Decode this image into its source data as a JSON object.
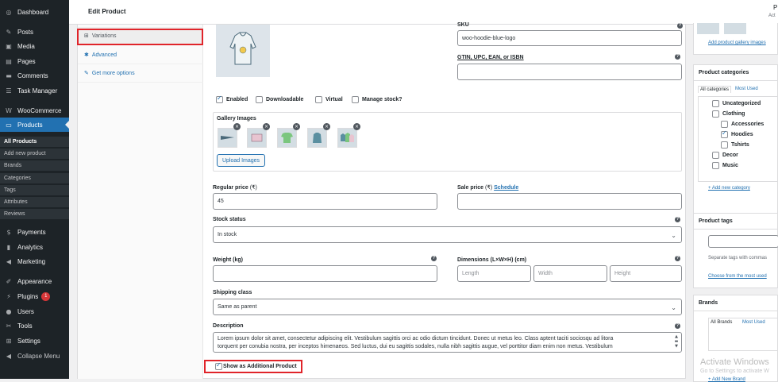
{
  "sidebar": {
    "items": [
      {
        "icon": "dashboard-icon",
        "glyph": "◎",
        "label": "Dashboard"
      },
      {
        "icon": "pin-icon",
        "glyph": "✎",
        "label": "Posts"
      },
      {
        "icon": "media-icon",
        "glyph": "▣",
        "label": "Media"
      },
      {
        "icon": "pages-icon",
        "glyph": "▤",
        "label": "Pages"
      },
      {
        "icon": "comment-icon",
        "glyph": "▬",
        "label": "Comments"
      },
      {
        "icon": "list-icon",
        "glyph": "☰",
        "label": "Task Manager"
      },
      {
        "icon": "woo-icon",
        "glyph": "W",
        "label": "WooCommerce"
      },
      {
        "icon": "products-icon",
        "glyph": "▭",
        "label": "Products"
      },
      {
        "icon": "payments-icon",
        "glyph": "$",
        "label": "Payments"
      },
      {
        "icon": "analytics-icon",
        "glyph": "▮",
        "label": "Analytics"
      },
      {
        "icon": "megaphone-icon",
        "glyph": "◀",
        "label": "Marketing"
      },
      {
        "icon": "appearance-icon",
        "glyph": "✐",
        "label": "Appearance"
      },
      {
        "icon": "plugin-icon",
        "glyph": "⚡",
        "label": "Plugins",
        "badge": "1"
      },
      {
        "icon": "users-icon",
        "glyph": "●",
        "label": "Users"
      },
      {
        "icon": "tools-icon",
        "glyph": "✂",
        "label": "Tools"
      },
      {
        "icon": "settings-icon",
        "glyph": "⊞",
        "label": "Settings"
      },
      {
        "icon": "collapse-icon",
        "glyph": "◀",
        "label": "Collapse Menu"
      }
    ],
    "submenu": [
      "All Products",
      "Add new product",
      "Brands",
      "Categories",
      "Tags",
      "Attributes",
      "Reviews"
    ]
  },
  "header": {
    "title": "Edit Product",
    "clip_right_1": "P",
    "clip_right_2": "Act"
  },
  "tabs": [
    {
      "icon": "grid-icon",
      "glyph": "⊞",
      "label": "Variations"
    },
    {
      "icon": "gear-icon",
      "glyph": "✱",
      "label": "Advanced"
    },
    {
      "icon": "plugin-icon",
      "glyph": "✎",
      "label": "Get more options"
    }
  ],
  "variation": {
    "sku_label": "SKU",
    "sku_value": "woo-hoodie-blue-logo",
    "gtin_label": "GTIN, UPC, EAN, or ISBN",
    "gtin_value": "",
    "checks": [
      {
        "label": "Enabled",
        "checked": true
      },
      {
        "label": "Downloadable",
        "checked": false
      },
      {
        "label": "Virtual",
        "checked": false
      },
      {
        "label": "Manage stock?",
        "checked": false
      }
    ],
    "gallery_label": "Gallery Images",
    "gallery_items": [
      "pennant-thumbnail",
      "tag-thumbnail",
      "tshirt-thumbnail",
      "hoodie-thumbnail",
      "hoodies-thumbnail"
    ],
    "upload_label": "Upload Images",
    "regular_price_label": "Regular price",
    "regular_price_currency": "(₹)",
    "regular_price_value": "45",
    "sale_price_label": "Sale price",
    "sale_price_currency": "(₹)",
    "schedule_label": "Schedule",
    "sale_price_value": "",
    "stock_status_label": "Stock status",
    "stock_status_value": "In stock",
    "weight_label": "Weight (kg)",
    "weight_value": "",
    "dimensions_label": "Dimensions (L×W×H) (cm)",
    "length_placeholder": "Length",
    "width_placeholder": "Width",
    "height_placeholder": "Height",
    "shipping_label": "Shipping class",
    "shipping_value": "Same as parent",
    "description_label": "Description",
    "description_line1": "Lorem ipsum dolor sit amet, consectetur adipiscing elit. Vestibulum sagittis orci ac odio dictum tincidunt. Donec ut metus leo. Class aptent taciti sociosqu ad litora",
    "description_line2": "torquent per conubia nostra, per inceptos himenaeos. Sed luctus, dui eu sagittis sodales, nulla nibh sagittis augue, vel porttitor diam enim non metus. Vestibulum",
    "additional_label": "Show as Additional Product",
    "additional_checked": true
  },
  "right": {
    "gallery_link": "Add product gallery images",
    "categories_title": "Product categories",
    "cat_tab_all": "All categories",
    "cat_tab_most": "Most Used",
    "categories": [
      {
        "label": "Uncategorized",
        "checked": false,
        "level": 0
      },
      {
        "label": "Clothing",
        "checked": false,
        "level": 0
      },
      {
        "label": "Accessories",
        "checked": false,
        "level": 1
      },
      {
        "label": "Hoodies",
        "checked": true,
        "level": 1
      },
      {
        "label": "Tshirts",
        "checked": false,
        "level": 1
      },
      {
        "label": "Decor",
        "checked": false,
        "level": 0
      },
      {
        "label": "Music",
        "checked": false,
        "level": 0
      }
    ],
    "add_category": "+ Add new category",
    "tags_title": "Product tags",
    "tags_hint": "Separate tags with commas",
    "tags_choose": "Choose from the most used",
    "brands_title": "Brands",
    "brand_tab_all": "All Brands",
    "brand_tab_most": "Most Used",
    "add_brand": "+ Add New Brand"
  },
  "watermark": {
    "line1": "Activate Windows",
    "line2": "Go to Settings to activate W"
  },
  "colors": {
    "sidebar": "#1d2327",
    "accent": "#2271b1",
    "highlight": "#e0242a"
  }
}
